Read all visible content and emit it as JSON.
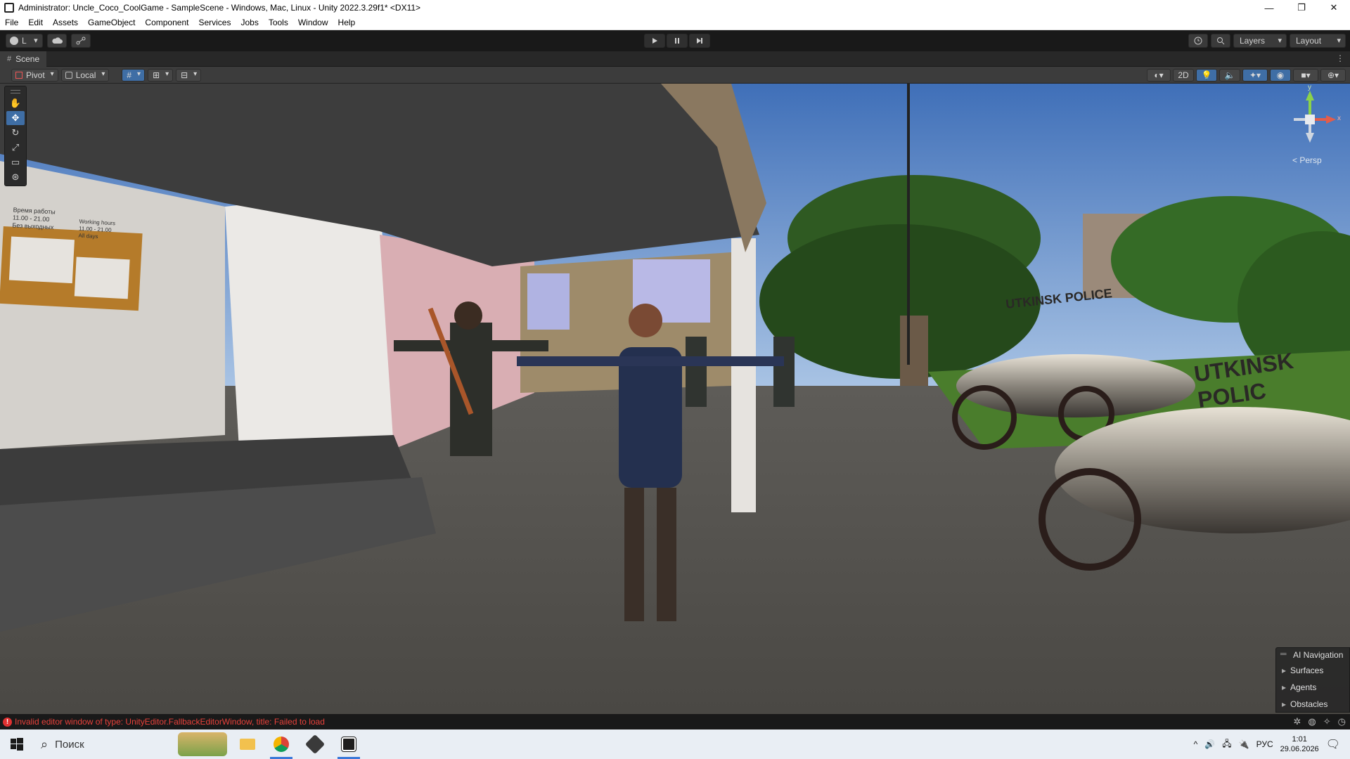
{
  "window": {
    "title": "Administrator: Uncle_Coco_CoolGame - SampleScene - Windows, Mac, Linux - Unity 2022.3.29f1* <DX11>",
    "controls": [
      "—",
      "❐",
      "✕"
    ]
  },
  "menu": [
    "File",
    "Edit",
    "Assets",
    "GameObject",
    "Component",
    "Services",
    "Jobs",
    "Tools",
    "Window",
    "Help"
  ],
  "toolbar": {
    "account_label": "L",
    "layers_label": "Layers",
    "layout_label": "Layout"
  },
  "scene_tab": {
    "label": "Scene"
  },
  "scene_toolbar": {
    "pivot_label": "Pivot",
    "local_label": "Local",
    "mode_2d_label": "2D"
  },
  "gizmo": {
    "persp_label": "< Persp",
    "x_label": "x",
    "y_label": "y"
  },
  "scene_props": {
    "sign_ru_line1": "Время работы",
    "sign_ru_line2": "11.00 - 21.00",
    "sign_ru_line3": "Без выходных",
    "sign_en_line1": "Working hours",
    "sign_en_line2": "11.00 - 21.00",
    "sign_en_line3": "All days",
    "car1_text": "UTKINSK POLICE",
    "car2_text": "UTKINSK POLIC"
  },
  "ai_navigation": {
    "title": "AI Navigation",
    "items": [
      "Surfaces",
      "Agents",
      "Obstacles"
    ]
  },
  "status": {
    "error_message": "Invalid editor window of type: UnityEditor.FallbackEditorWindow, title: Failed to load"
  },
  "taskbar": {
    "search_placeholder": "Поиск",
    "language": "РУС",
    "time": "1:01",
    "date": "29.06.2026"
  },
  "colors": {
    "editor_bg": "#191919",
    "panel_bg": "#3c3c3c",
    "active_tool": "#3f6ea5",
    "error_red": "#e8413a",
    "sky": "#5a86c4"
  }
}
